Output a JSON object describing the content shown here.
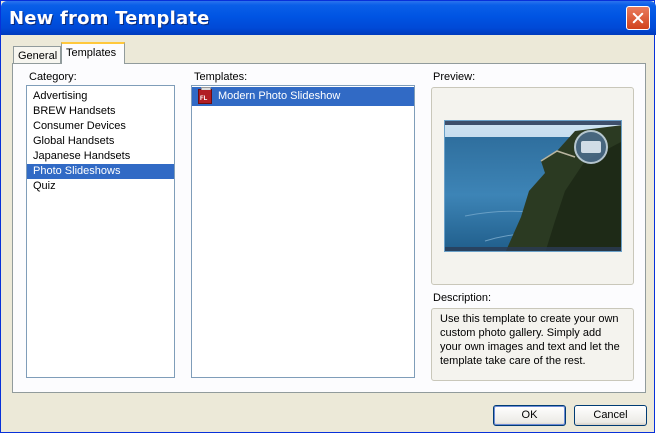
{
  "window": {
    "title": "New from Template"
  },
  "tabs": [
    {
      "label": "General"
    },
    {
      "label": "Templates"
    }
  ],
  "category": {
    "label": "Category:",
    "items": [
      "Advertising",
      "BREW Handsets",
      "Consumer Devices",
      "Global Handsets",
      "Japanese Handsets",
      "Photo Slideshows",
      "Quiz"
    ],
    "selected": "Photo Slideshows"
  },
  "templates": {
    "label": "Templates:",
    "items": [
      {
        "label": "Modern Photo Slideshow",
        "icon": "flash-document-icon",
        "icon_text": "FL"
      }
    ]
  },
  "preview": {
    "label": "Preview:"
  },
  "description": {
    "label": "Description:",
    "text": "Use this template to create your own custom photo gallery. Simply add your own images and text and let the template take care of the rest."
  },
  "buttons": {
    "ok": "OK",
    "cancel": "Cancel"
  },
  "colors": {
    "title_bar": "#0054e3",
    "selection": "#316ac5",
    "dialog_bg": "#ece9d8",
    "close_button": "#d1421b"
  }
}
